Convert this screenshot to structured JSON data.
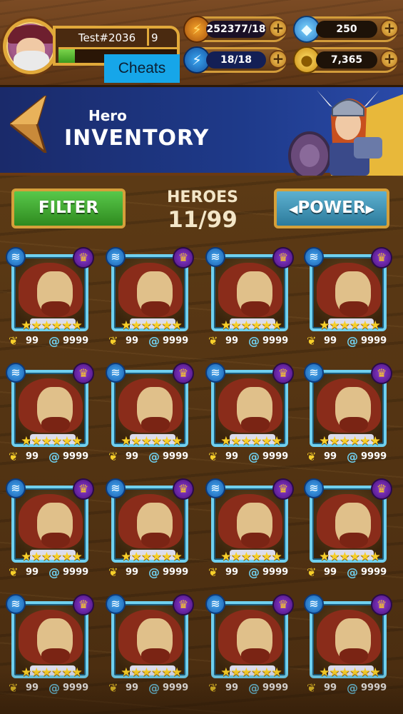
{
  "player": {
    "name": "Test#2036",
    "level": "9",
    "xp_fraction": 0.14
  },
  "cheats_label": "Cheats",
  "resources": {
    "energy": "252377/18",
    "gems": "250",
    "stamina": "18/18",
    "gold": "7,365"
  },
  "banner": {
    "subtitle": "Hero",
    "title": "INVENTORY"
  },
  "filter_label": "FILTER",
  "power_label": "POWER",
  "heroes_label": "HEROES",
  "heroes_count": "11/99",
  "heroes": [
    {
      "power": "99",
      "souls": "9999",
      "stars": "★★★★★★"
    },
    {
      "power": "99",
      "souls": "9999",
      "stars": "★★★★★★"
    },
    {
      "power": "99",
      "souls": "9999",
      "stars": "★★★★★★"
    },
    {
      "power": "99",
      "souls": "9999",
      "stars": "★★★★★★"
    },
    {
      "power": "99",
      "souls": "9999",
      "stars": "★★★★★★"
    },
    {
      "power": "99",
      "souls": "9999",
      "stars": "★★★★★★"
    },
    {
      "power": "99",
      "souls": "9999",
      "stars": "★★★★★★"
    },
    {
      "power": "99",
      "souls": "9999",
      "stars": "★★★★★★"
    },
    {
      "power": "99",
      "souls": "9999",
      "stars": "★★★★★★"
    },
    {
      "power": "99",
      "souls": "9999",
      "stars": "★★★★★★"
    },
    {
      "power": "99",
      "souls": "9999",
      "stars": "★★★★★★"
    },
    {
      "power": "99",
      "souls": "9999",
      "stars": "★★★★★★"
    },
    {
      "power": "99",
      "souls": "9999",
      "stars": "★★★★★★"
    },
    {
      "power": "99",
      "souls": "9999",
      "stars": "★★★★★★"
    },
    {
      "power": "99",
      "souls": "9999",
      "stars": "★★★★★★"
    },
    {
      "power": "99",
      "souls": "9999",
      "stars": "★★★★★★"
    }
  ],
  "icons": {
    "energy": "energy-orb-icon",
    "gems": "diamond-icon",
    "stamina": "lightning-icon",
    "gold": "gold-coin-icon",
    "element": "water-wave-icon",
    "class": "crown-icon",
    "power": "power-laurel-icon",
    "souls": "soul-swirl-icon"
  },
  "colors": {
    "accent_gold": "#d39c3a",
    "filter_green": "#3fae30",
    "power_blue": "#3d94b8",
    "cheats_blue": "#16a6e9",
    "banner_blue": "#1e3a8a"
  }
}
